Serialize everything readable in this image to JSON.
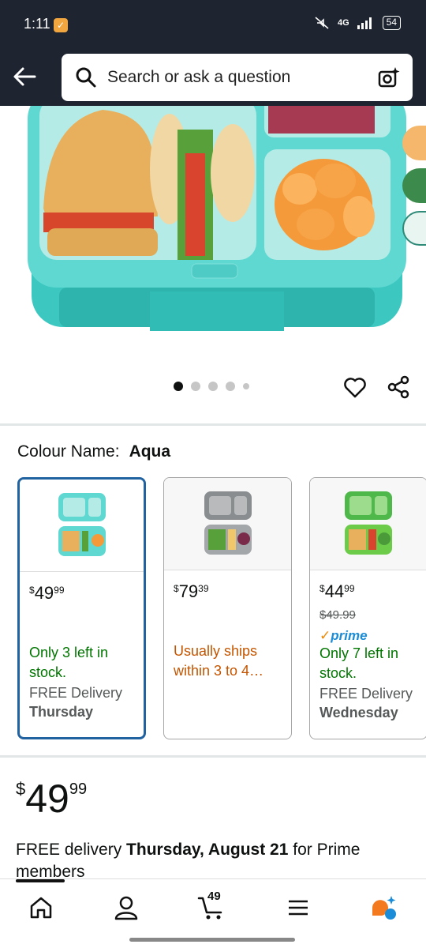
{
  "status": {
    "time": "1:11",
    "network": "4G",
    "battery": "54"
  },
  "search": {
    "placeholder": "Search or ask a question"
  },
  "colour": {
    "label": "Colour Name:",
    "value": "Aqua"
  },
  "variants": [
    {
      "name": "aqua",
      "price_whole": "49",
      "price_cents": "99",
      "currency": "$",
      "stock": "Only 3 left in stock.",
      "delivery": "FREE Delivery",
      "delivery_day": "Thursday"
    },
    {
      "name": "gray",
      "price_whole": "79",
      "price_cents": "39",
      "currency": "$",
      "stock": "Usually ships within 3 to 4…"
    },
    {
      "name": "green",
      "price_whole": "44",
      "price_cents": "99",
      "currency": "$",
      "list_price": "$49.99",
      "prime": "prime",
      "stock": "Only 7 left in stock.",
      "delivery": "FREE Delivery",
      "delivery_day": "Wednesday"
    }
  ],
  "main_price": {
    "currency": "$",
    "whole": "49",
    "cents": "99"
  },
  "delivery_info": {
    "prefix": "FREE delivery",
    "date": "Thursday, August 21",
    "suffix": "for Prime members"
  },
  "cart": {
    "count": "49"
  },
  "colors": {
    "header_bg": "#1f2530",
    "selected_border": "#2162a1",
    "in_stock": "#007600",
    "ships_later": "#c45500"
  }
}
